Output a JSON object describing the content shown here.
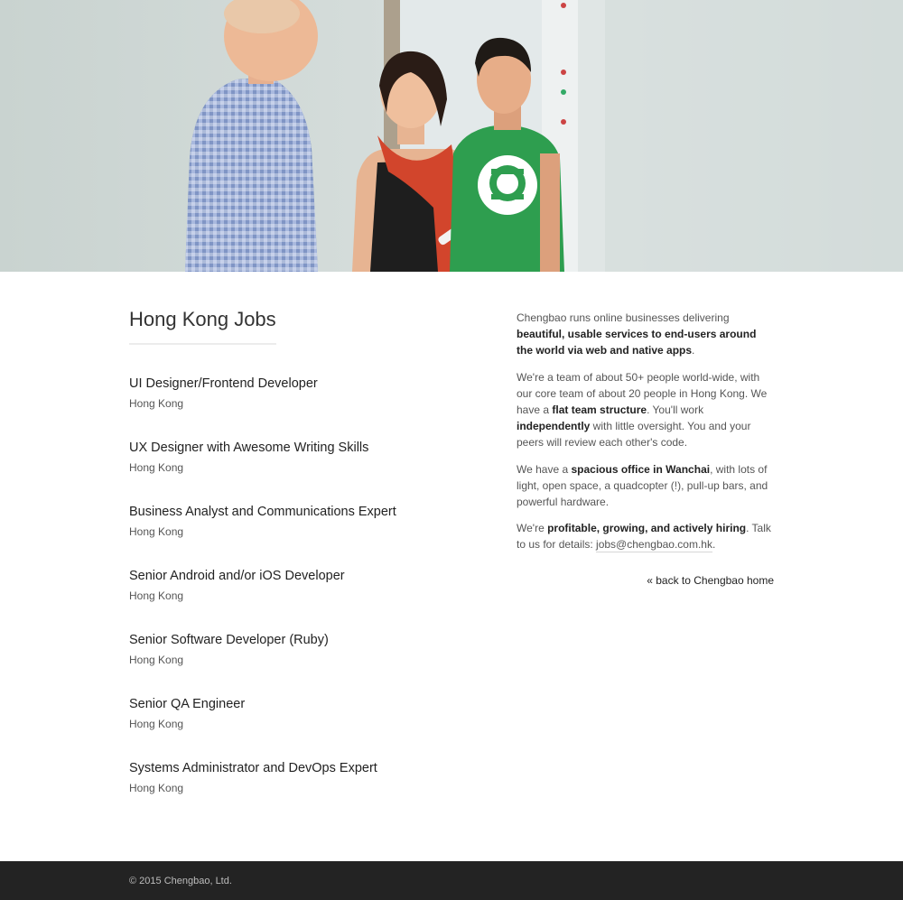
{
  "hero": {
    "image_description": "Photo of three colleagues talking in a bright office",
    "colors": {
      "background": "#d4dcda",
      "green_shirt": "#2e9e4f",
      "red_scarf": "#d2452c"
    },
    "icons": [
      "hero-photo"
    ]
  },
  "main": {
    "title": "Hong Kong Jobs",
    "jobs": [
      {
        "title": "UI Designer/Frontend Developer",
        "location": "Hong Kong"
      },
      {
        "title": "UX Designer with Awesome Writing Skills",
        "location": "Hong Kong"
      },
      {
        "title": "Business Analyst and Communications Expert",
        "location": "Hong Kong"
      },
      {
        "title": "Senior Android and/or iOS Developer",
        "location": "Hong Kong"
      },
      {
        "title": "Senior Software Developer (Ruby)",
        "location": "Hong Kong"
      },
      {
        "title": "Senior QA Engineer",
        "location": "Hong Kong"
      },
      {
        "title": "Systems Administrator and DevOps Expert",
        "location": "Hong Kong"
      }
    ]
  },
  "sidebar": {
    "p1": {
      "a": "Chengbao runs online businesses delivering ",
      "b": "beautiful, usable services to end-users around the world via web and native apps",
      "c": "."
    },
    "p2": {
      "a": "We're a team of about 50+ people world-wide, with our core team of about 20 people in Hong Kong. We have a ",
      "b": "flat team structure",
      "c": ". You'll work ",
      "d": "independently",
      "e": " with little oversight. You and your peers will review each other's code."
    },
    "p3": {
      "a": "We have a ",
      "b": "spacious office in Wanchai",
      "c": ", with lots of light, open space, a quadcopter (!), pull-up bars, and powerful hardware."
    },
    "p4": {
      "a": "We're ",
      "b": "profitable, growing, and actively hiring",
      "c": ". Talk to us for details: ",
      "email": "jobs@chengbao.com.hk",
      "d": "."
    },
    "back_link": "« back to Chengbao home"
  },
  "footer": {
    "copyright": "© 2015 Chengbao, Ltd.",
    "colors": {
      "background": "#232323",
      "text": "#bdbdbd"
    }
  }
}
